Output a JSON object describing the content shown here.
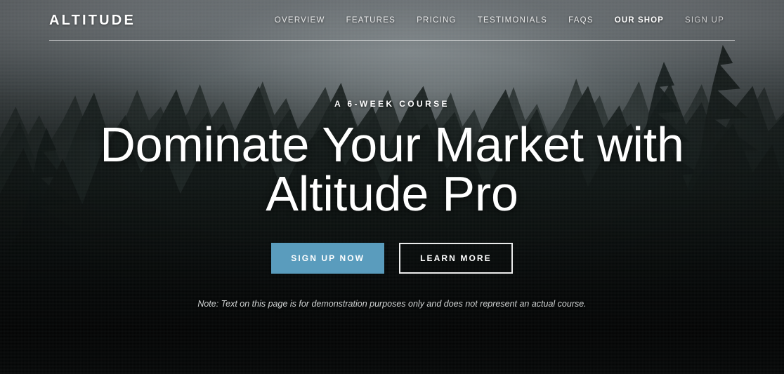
{
  "header": {
    "logo": "ALTITUDE",
    "nav": [
      {
        "label": "OVERVIEW",
        "active": false
      },
      {
        "label": "FEATURES",
        "active": false
      },
      {
        "label": "PRICING",
        "active": false
      },
      {
        "label": "TESTIMONIALS",
        "active": false
      },
      {
        "label": "FAQS",
        "active": false
      },
      {
        "label": "OUR SHOP",
        "active": true
      },
      {
        "label": "SIGN UP",
        "active": false
      }
    ]
  },
  "hero": {
    "eyebrow": "A 6-WEEK COURSE",
    "title": "Dominate Your Market with Altitude Pro",
    "primary_button": "SIGN UP NOW",
    "secondary_button": "LEARN MORE",
    "note": "Note: Text on this page is for demonstration purposes only and does not represent an actual course."
  },
  "colors": {
    "accent": "#5a9cbd",
    "text_light": "#ffffff",
    "sky_top": "#8b9196",
    "forest_dark": "#0e1312",
    "page_bottom": "#050707"
  },
  "background": {
    "subject": "misty coniferous forest at dusk"
  }
}
